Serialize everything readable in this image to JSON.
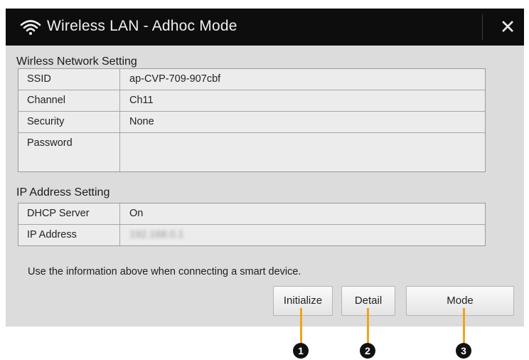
{
  "window": {
    "title": "Wireless LAN - Adhoc Mode",
    "close_symbol": "✕",
    "icons": {
      "title": "wifi-icon",
      "close": "close-icon"
    }
  },
  "wireless_section": {
    "title": "Wirless Network Setting",
    "rows": [
      {
        "label": "SSID",
        "value": "ap-CVP-709-907cbf"
      },
      {
        "label": "Channel",
        "value": "Ch11"
      },
      {
        "label": "Security",
        "value": "None"
      },
      {
        "label": "Password",
        "value": ""
      }
    ]
  },
  "ip_section": {
    "title": "IP Address Setting",
    "rows": [
      {
        "label": "DHCP Server",
        "value": "On"
      },
      {
        "label": "IP Address",
        "value": "192.168.0.1"
      }
    ]
  },
  "info_text": "Use the information above when connecting a smart device.",
  "buttons": {
    "initialize": "Initialize",
    "detail": "Detail",
    "mode": "Mode"
  },
  "callouts": [
    "1",
    "2",
    "3"
  ],
  "colors": {
    "titlebar": "#0d0d0d",
    "dialog_bg": "#dcdcdc",
    "callout_line": "#f0a31a"
  }
}
